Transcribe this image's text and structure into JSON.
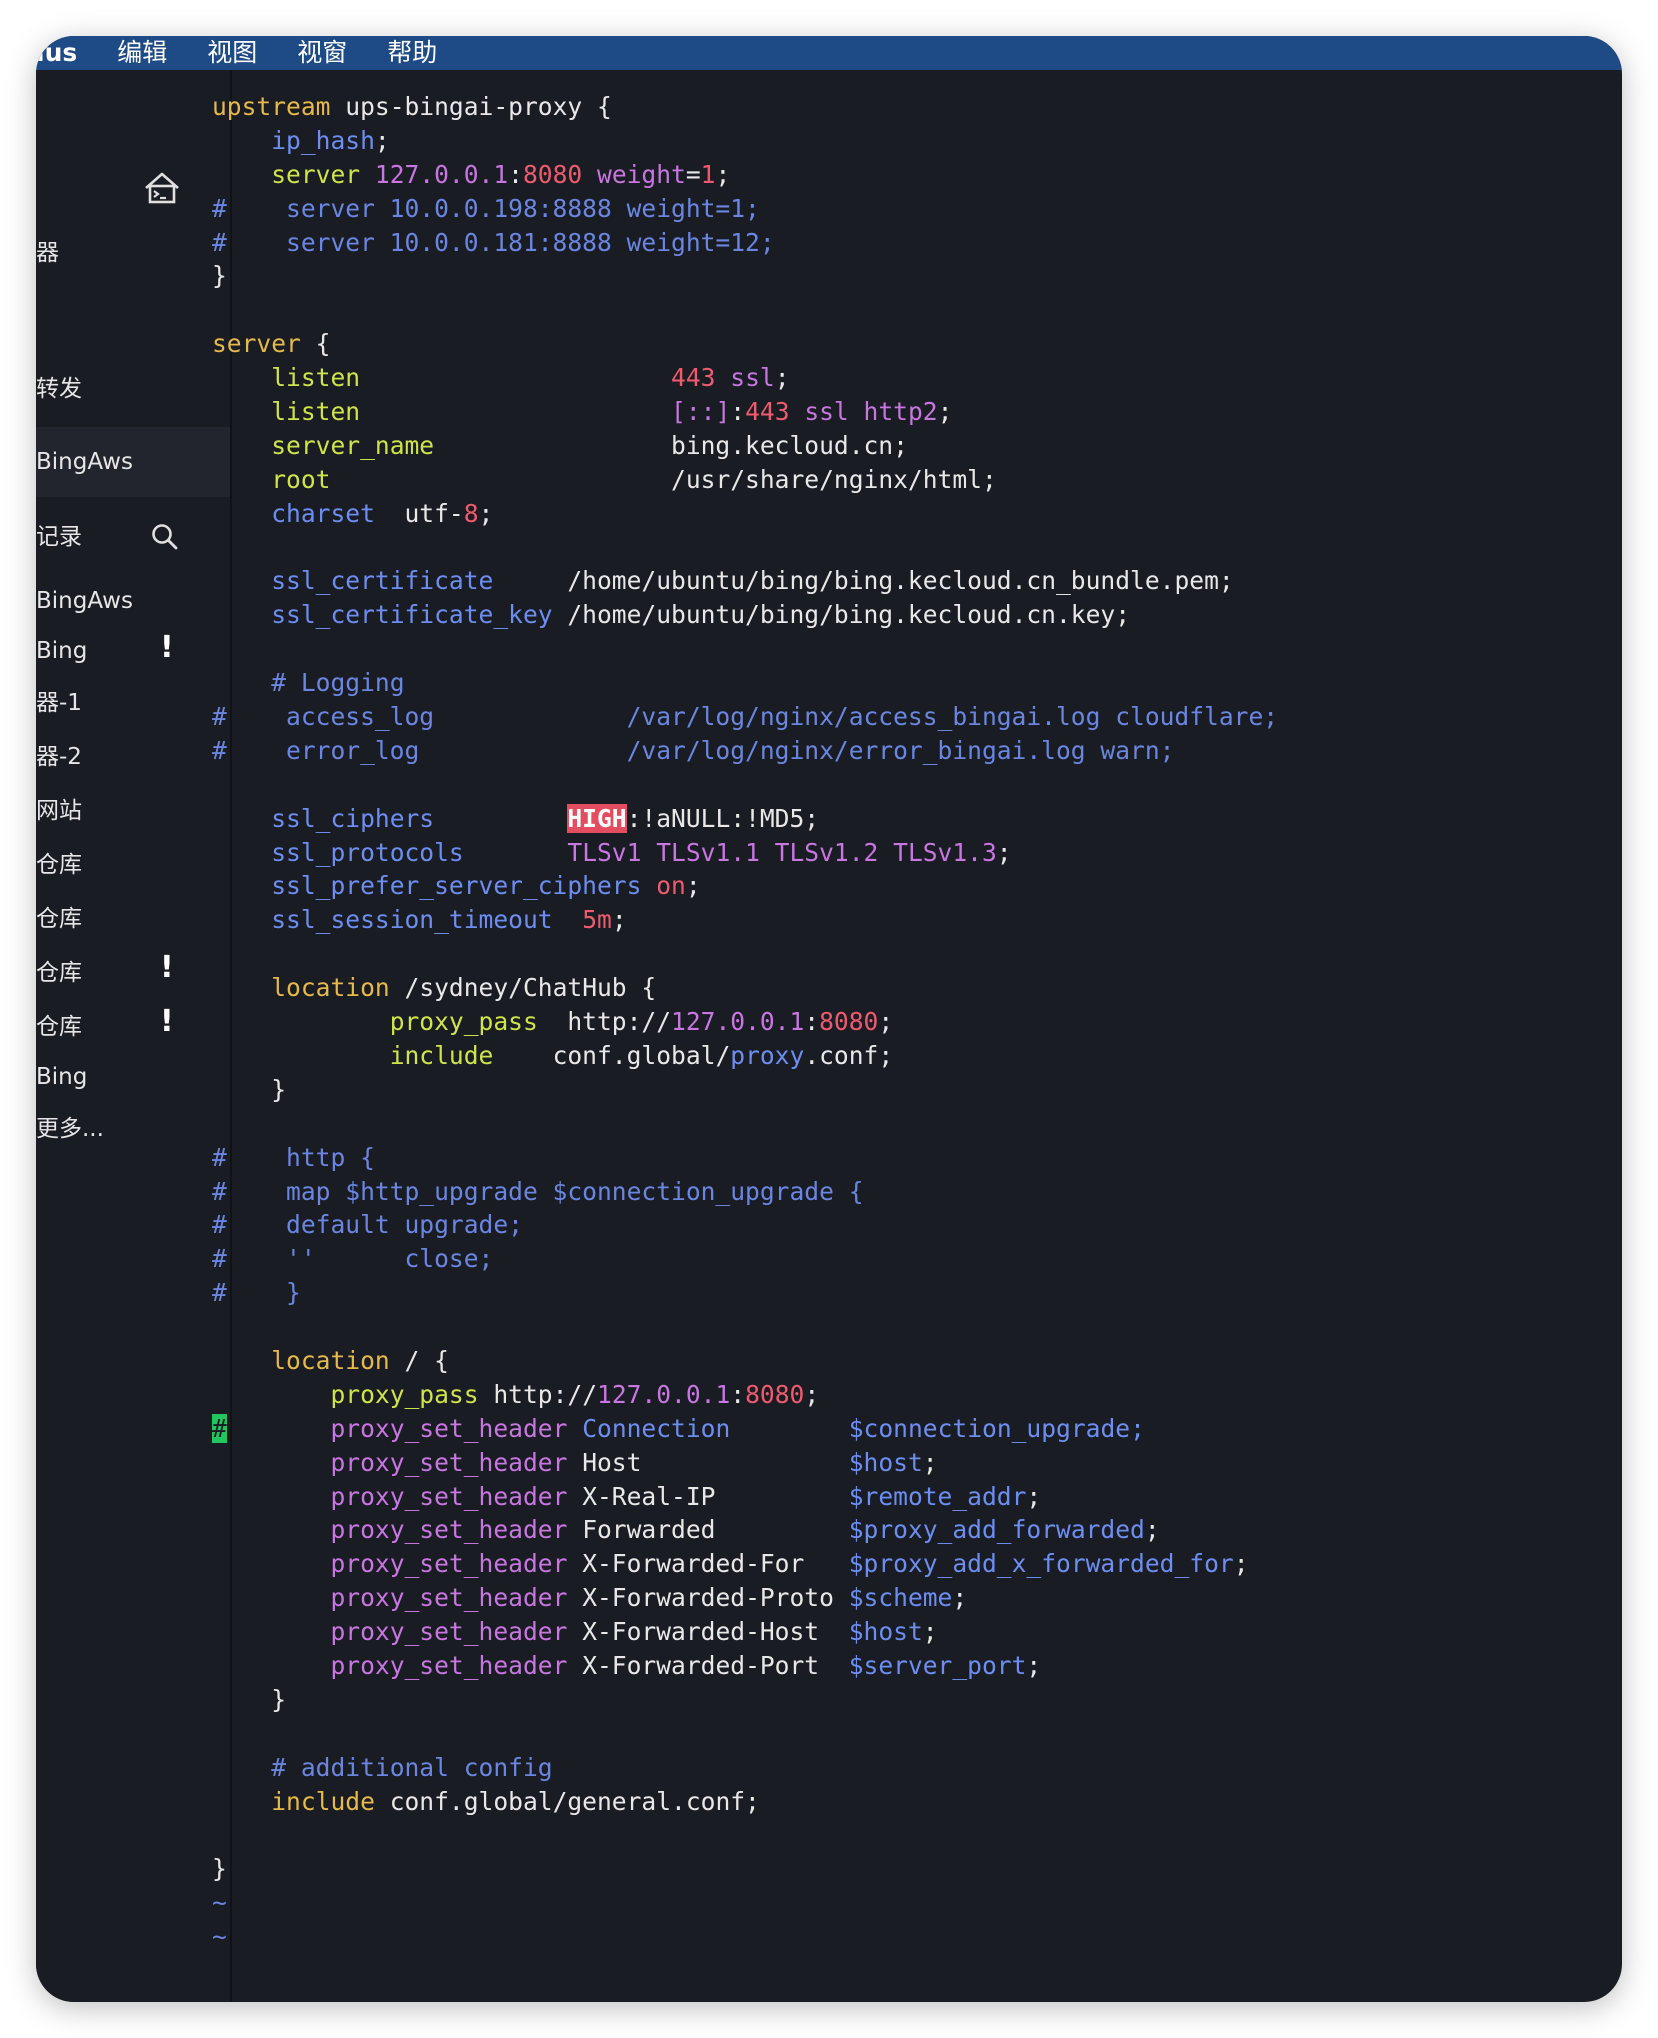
{
  "menubar": {
    "app": "lus",
    "items": [
      "编辑",
      "视图",
      "视窗",
      "帮助"
    ]
  },
  "sidebar": {
    "items": [
      {
        "label": "器",
        "top": 0
      },
      {
        "label": "转发"
      },
      {
        "label": "BingAws"
      },
      {
        "label": "记录"
      },
      {
        "label": "BingAws"
      },
      {
        "label": "Bing"
      },
      {
        "label": "器-1"
      },
      {
        "label": "器-2"
      },
      {
        "label": "网站"
      },
      {
        "label": "仓库"
      },
      {
        "label": "仓库"
      },
      {
        "label": "仓库"
      },
      {
        "label": "仓库"
      },
      {
        "label": "Bing"
      },
      {
        "label": "更多..."
      }
    ],
    "alert_symbol": "!"
  },
  "code": {
    "lines": [
      [
        [
          "k",
          "upstream"
        ],
        [
          "w",
          " ups-bingai-proxy {"
        ]
      ],
      [
        [
          "w",
          "    "
        ],
        [
          "v",
          "ip_hash"
        ],
        [
          "w",
          ";"
        ]
      ],
      [
        [
          "w",
          "    "
        ],
        [
          "d",
          "server"
        ],
        [
          "w",
          " "
        ],
        [
          "p",
          "127.0.0.1"
        ],
        [
          "w",
          ":"
        ],
        [
          "n",
          "8080"
        ],
        [
          "w",
          " "
        ],
        [
          "p",
          "weight"
        ],
        [
          "w",
          "="
        ],
        [
          "n",
          "1"
        ],
        [
          "w",
          ";"
        ]
      ],
      [
        [
          "c",
          "#    server 10.0.0.198:8888 weight=1;"
        ]
      ],
      [
        [
          "c",
          "#    server 10.0.0.181:8888 weight=12;"
        ]
      ],
      [
        [
          "w",
          "}"
        ]
      ],
      [
        [
          "w",
          ""
        ]
      ],
      [
        [
          "k",
          "server"
        ],
        [
          "w",
          " {"
        ]
      ],
      [
        [
          "w",
          "    "
        ],
        [
          "d",
          "listen"
        ],
        [
          "w",
          "                     "
        ],
        [
          "n",
          "443"
        ],
        [
          "w",
          " "
        ],
        [
          "p",
          "ssl"
        ],
        [
          "w",
          ";"
        ]
      ],
      [
        [
          "w",
          "    "
        ],
        [
          "d",
          "listen"
        ],
        [
          "w",
          "                     "
        ],
        [
          "p",
          "[::]"
        ],
        [
          "w",
          ":"
        ],
        [
          "n",
          "443"
        ],
        [
          "w",
          " "
        ],
        [
          "p",
          "ssl"
        ],
        [
          "w",
          " "
        ],
        [
          "p",
          "http2"
        ],
        [
          "w",
          ";"
        ]
      ],
      [
        [
          "w",
          "    "
        ],
        [
          "d",
          "server_name"
        ],
        [
          "w",
          "                bing.kecloud.cn;"
        ]
      ],
      [
        [
          "w",
          "    "
        ],
        [
          "d",
          "root"
        ],
        [
          "w",
          "                       /usr/share/nginx/html;"
        ]
      ],
      [
        [
          "w",
          "    "
        ],
        [
          "v",
          "charset"
        ],
        [
          "w",
          "  utf-"
        ],
        [
          "n",
          "8"
        ],
        [
          "w",
          ";"
        ]
      ],
      [
        [
          "w",
          ""
        ]
      ],
      [
        [
          "w",
          "    "
        ],
        [
          "v",
          "ssl_certificate"
        ],
        [
          "w",
          "     /home/ubuntu/bing/bing.kecloud.cn_bundle.pem;"
        ]
      ],
      [
        [
          "w",
          "    "
        ],
        [
          "v",
          "ssl_certificate_key"
        ],
        [
          "w",
          " /home/ubuntu/bing/bing.kecloud.cn.key;"
        ]
      ],
      [
        [
          "w",
          ""
        ]
      ],
      [
        [
          "w",
          "    "
        ],
        [
          "c",
          "# Logging"
        ]
      ],
      [
        [
          "c",
          "#    access_log             /var/log/nginx/access_bingai.log cloudflare;"
        ]
      ],
      [
        [
          "c",
          "#    error_log              /var/log/nginx/error_bingai.log warn;"
        ]
      ],
      [
        [
          "w",
          ""
        ]
      ],
      [
        [
          "w",
          "    "
        ],
        [
          "v",
          "ssl_ciphers"
        ],
        [
          "w",
          "         "
        ],
        [
          "hl",
          "HIGH"
        ],
        [
          "w",
          ":!aNULL:!MD5;"
        ]
      ],
      [
        [
          "w",
          "    "
        ],
        [
          "v",
          "ssl_protocols"
        ],
        [
          "w",
          "       "
        ],
        [
          "p",
          "TLSv1 TLSv1.1 TLSv1.2 TLSv1.3"
        ],
        [
          "w",
          ";"
        ]
      ],
      [
        [
          "w",
          "    "
        ],
        [
          "v",
          "ssl_prefer_server_ciphers"
        ],
        [
          "w",
          " "
        ],
        [
          "n",
          "on"
        ],
        [
          "w",
          ";"
        ]
      ],
      [
        [
          "w",
          "    "
        ],
        [
          "v",
          "ssl_session_timeout"
        ],
        [
          "w",
          "  "
        ],
        [
          "n",
          "5m"
        ],
        [
          "w",
          ";"
        ]
      ],
      [
        [
          "w",
          ""
        ]
      ],
      [
        [
          "w",
          "    "
        ],
        [
          "k",
          "location"
        ],
        [
          "w",
          " /sydney/ChatHub {"
        ]
      ],
      [
        [
          "w",
          "            "
        ],
        [
          "d",
          "proxy_pass"
        ],
        [
          "w",
          "  http://"
        ],
        [
          "p",
          "127.0.0.1"
        ],
        [
          "w",
          ":"
        ],
        [
          "n",
          "8080"
        ],
        [
          "w",
          ";"
        ]
      ],
      [
        [
          "w",
          "            "
        ],
        [
          "d",
          "include"
        ],
        [
          "w",
          "    conf.global/"
        ],
        [
          "v",
          "proxy"
        ],
        [
          "w",
          ".conf;"
        ]
      ],
      [
        [
          "w",
          "    }"
        ]
      ],
      [
        [
          "w",
          ""
        ]
      ],
      [
        [
          "c",
          "#    http {"
        ]
      ],
      [
        [
          "c",
          "#    map $http_upgrade $connection_upgrade {"
        ]
      ],
      [
        [
          "c",
          "#    default upgrade;"
        ]
      ],
      [
        [
          "c",
          "#    ''      close;"
        ]
      ],
      [
        [
          "c",
          "#    }"
        ]
      ],
      [
        [
          "w",
          ""
        ]
      ],
      [
        [
          "w",
          "    "
        ],
        [
          "k",
          "location"
        ],
        [
          "w",
          " / {"
        ]
      ],
      [
        [
          "w",
          "        "
        ],
        [
          "d",
          "proxy_pass"
        ],
        [
          "w",
          " http://"
        ],
        [
          "p",
          "127.0.0.1"
        ],
        [
          "w",
          ":"
        ],
        [
          "n",
          "8080"
        ],
        [
          "w",
          ";"
        ]
      ],
      [
        [
          "cursor",
          "#"
        ],
        [
          "w",
          "       "
        ],
        [
          "p",
          "proxy_set_header"
        ],
        [
          "w",
          " "
        ],
        [
          "v",
          "Connection"
        ],
        [
          "w",
          "        "
        ],
        [
          "v",
          "$connection_upgrade;"
        ]
      ],
      [
        [
          "w",
          "        "
        ],
        [
          "p",
          "proxy_set_header"
        ],
        [
          "w",
          " Host              "
        ],
        [
          "v",
          "$host"
        ],
        [
          "w",
          ";"
        ]
      ],
      [
        [
          "w",
          "        "
        ],
        [
          "p",
          "proxy_set_header"
        ],
        [
          "w",
          " X-Real-IP         "
        ],
        [
          "v",
          "$remote_addr"
        ],
        [
          "w",
          ";"
        ]
      ],
      [
        [
          "w",
          "        "
        ],
        [
          "p",
          "proxy_set_header"
        ],
        [
          "w",
          " Forwarded         "
        ],
        [
          "v",
          "$proxy_add_forwarded"
        ],
        [
          "w",
          ";"
        ]
      ],
      [
        [
          "w",
          "        "
        ],
        [
          "p",
          "proxy_set_header"
        ],
        [
          "w",
          " X-Forwarded-For   "
        ],
        [
          "v",
          "$proxy_add_x_forwarded_for"
        ],
        [
          "w",
          ";"
        ]
      ],
      [
        [
          "w",
          "        "
        ],
        [
          "p",
          "proxy_set_header"
        ],
        [
          "w",
          " X-Forwarded-Proto "
        ],
        [
          "v",
          "$scheme"
        ],
        [
          "w",
          ";"
        ]
      ],
      [
        [
          "w",
          "        "
        ],
        [
          "p",
          "proxy_set_header"
        ],
        [
          "w",
          " X-Forwarded-Host  "
        ],
        [
          "v",
          "$host"
        ],
        [
          "w",
          ";"
        ]
      ],
      [
        [
          "w",
          "        "
        ],
        [
          "p",
          "proxy_set_header"
        ],
        [
          "w",
          " X-Forwarded-Port  "
        ],
        [
          "v",
          "$server_port"
        ],
        [
          "w",
          ";"
        ]
      ],
      [
        [
          "w",
          "    }"
        ]
      ],
      [
        [
          "w",
          ""
        ]
      ],
      [
        [
          "w",
          "    "
        ],
        [
          "c",
          "# additional config"
        ]
      ],
      [
        [
          "w",
          "    "
        ],
        [
          "k",
          "include"
        ],
        [
          "w",
          " conf.global/general.conf;"
        ]
      ],
      [
        [
          "w",
          ""
        ]
      ],
      [
        [
          "w",
          "}"
        ]
      ],
      [
        [
          "tilde",
          "~"
        ]
      ],
      [
        [
          "tilde",
          "~"
        ]
      ]
    ]
  }
}
